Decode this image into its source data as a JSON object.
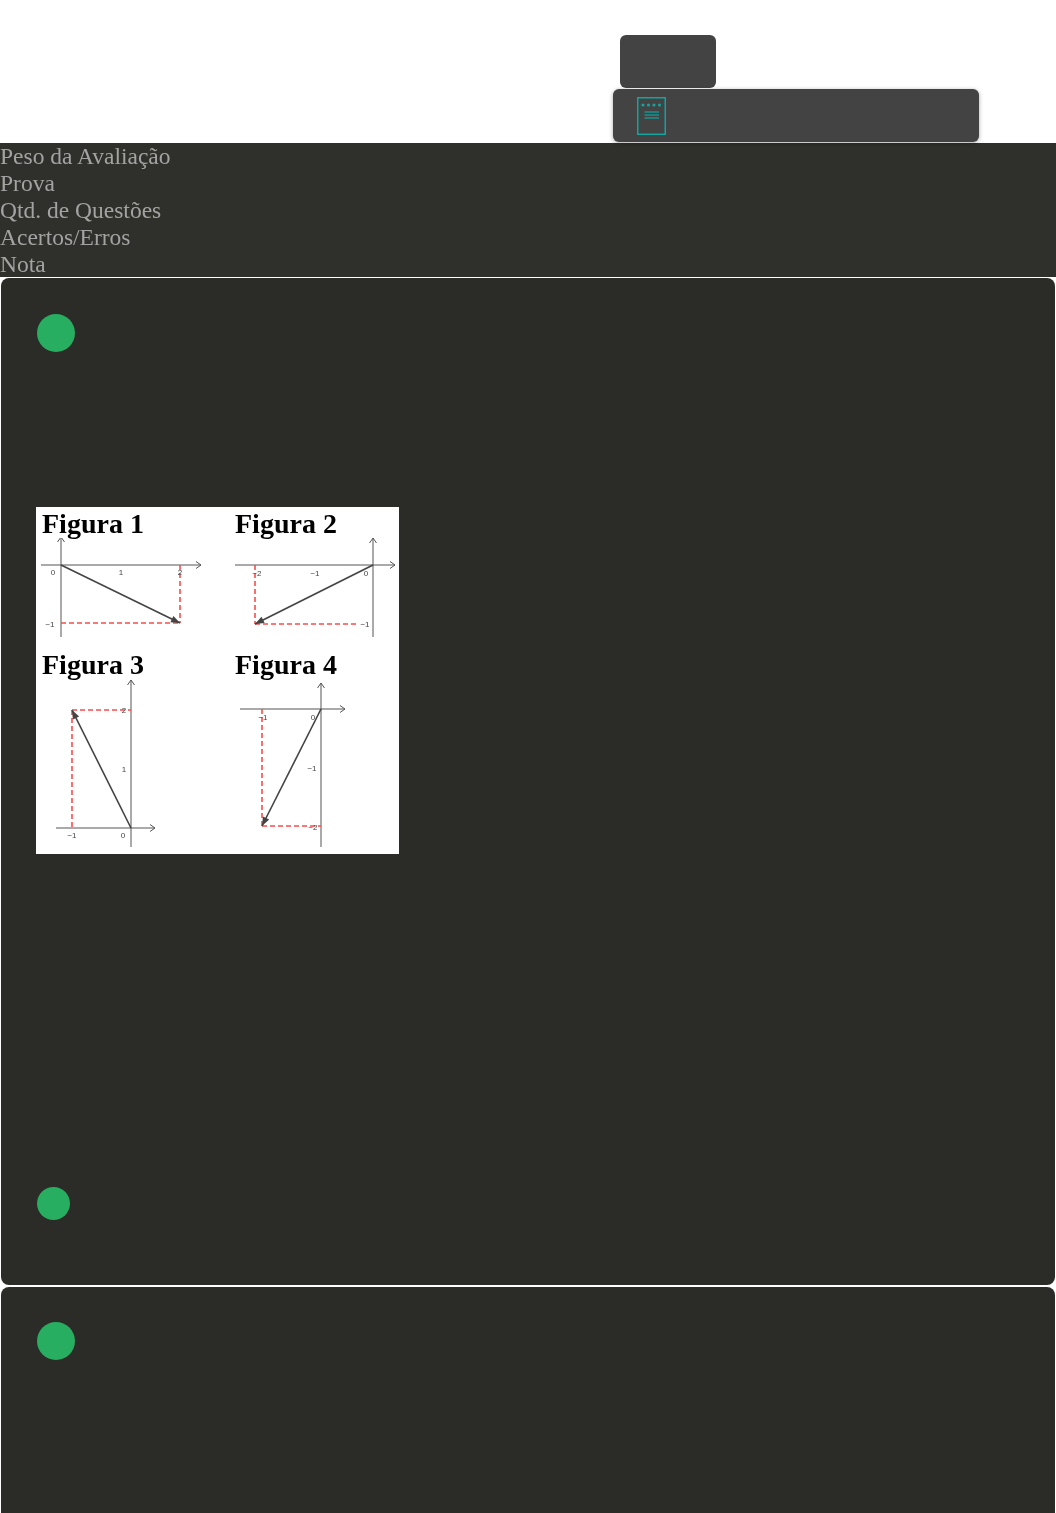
{
  "summary_labels": [
    "Peso da Avaliação",
    "Prova",
    "Qtd. de Questões",
    "Acertos/Erros",
    "Nota"
  ],
  "questions": [
    {
      "kind": "figure",
      "figure": {
        "panels": [
          {
            "title": "Figura 1",
            "tick_labels": [
              "0",
              "1",
              "2",
              "−1"
            ]
          },
          {
            "title": "Figura 2",
            "tick_labels": [
              "−2",
              "−1",
              "0",
              "−1"
            ]
          },
          {
            "title": "Figura 3",
            "tick_labels": [
              "2",
              "1",
              "−1",
              "0"
            ]
          },
          {
            "title": "Figura 4",
            "tick_labels": [
              "−1",
              "0",
              "−1",
              "−2"
            ]
          }
        ]
      }
    },
    {
      "kind": "plain"
    }
  ]
}
